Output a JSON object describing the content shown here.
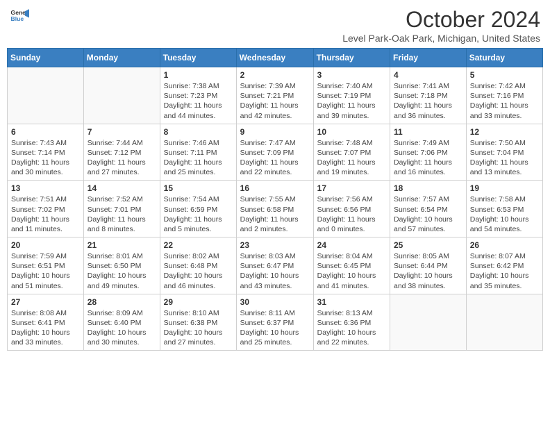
{
  "header": {
    "logo_line1": "General",
    "logo_line2": "Blue",
    "month_title": "October 2024",
    "location": "Level Park-Oak Park, Michigan, United States"
  },
  "weekdays": [
    "Sunday",
    "Monday",
    "Tuesday",
    "Wednesday",
    "Thursday",
    "Friday",
    "Saturday"
  ],
  "weeks": [
    [
      {
        "day": "",
        "info": ""
      },
      {
        "day": "",
        "info": ""
      },
      {
        "day": "1",
        "info": "Sunrise: 7:38 AM\nSunset: 7:23 PM\nDaylight: 11 hours and 44 minutes."
      },
      {
        "day": "2",
        "info": "Sunrise: 7:39 AM\nSunset: 7:21 PM\nDaylight: 11 hours and 42 minutes."
      },
      {
        "day": "3",
        "info": "Sunrise: 7:40 AM\nSunset: 7:19 PM\nDaylight: 11 hours and 39 minutes."
      },
      {
        "day": "4",
        "info": "Sunrise: 7:41 AM\nSunset: 7:18 PM\nDaylight: 11 hours and 36 minutes."
      },
      {
        "day": "5",
        "info": "Sunrise: 7:42 AM\nSunset: 7:16 PM\nDaylight: 11 hours and 33 minutes."
      }
    ],
    [
      {
        "day": "6",
        "info": "Sunrise: 7:43 AM\nSunset: 7:14 PM\nDaylight: 11 hours and 30 minutes."
      },
      {
        "day": "7",
        "info": "Sunrise: 7:44 AM\nSunset: 7:12 PM\nDaylight: 11 hours and 27 minutes."
      },
      {
        "day": "8",
        "info": "Sunrise: 7:46 AM\nSunset: 7:11 PM\nDaylight: 11 hours and 25 minutes."
      },
      {
        "day": "9",
        "info": "Sunrise: 7:47 AM\nSunset: 7:09 PM\nDaylight: 11 hours and 22 minutes."
      },
      {
        "day": "10",
        "info": "Sunrise: 7:48 AM\nSunset: 7:07 PM\nDaylight: 11 hours and 19 minutes."
      },
      {
        "day": "11",
        "info": "Sunrise: 7:49 AM\nSunset: 7:06 PM\nDaylight: 11 hours and 16 minutes."
      },
      {
        "day": "12",
        "info": "Sunrise: 7:50 AM\nSunset: 7:04 PM\nDaylight: 11 hours and 13 minutes."
      }
    ],
    [
      {
        "day": "13",
        "info": "Sunrise: 7:51 AM\nSunset: 7:02 PM\nDaylight: 11 hours and 11 minutes."
      },
      {
        "day": "14",
        "info": "Sunrise: 7:52 AM\nSunset: 7:01 PM\nDaylight: 11 hours and 8 minutes."
      },
      {
        "day": "15",
        "info": "Sunrise: 7:54 AM\nSunset: 6:59 PM\nDaylight: 11 hours and 5 minutes."
      },
      {
        "day": "16",
        "info": "Sunrise: 7:55 AM\nSunset: 6:58 PM\nDaylight: 11 hours and 2 minutes."
      },
      {
        "day": "17",
        "info": "Sunrise: 7:56 AM\nSunset: 6:56 PM\nDaylight: 11 hours and 0 minutes."
      },
      {
        "day": "18",
        "info": "Sunrise: 7:57 AM\nSunset: 6:54 PM\nDaylight: 10 hours and 57 minutes."
      },
      {
        "day": "19",
        "info": "Sunrise: 7:58 AM\nSunset: 6:53 PM\nDaylight: 10 hours and 54 minutes."
      }
    ],
    [
      {
        "day": "20",
        "info": "Sunrise: 7:59 AM\nSunset: 6:51 PM\nDaylight: 10 hours and 51 minutes."
      },
      {
        "day": "21",
        "info": "Sunrise: 8:01 AM\nSunset: 6:50 PM\nDaylight: 10 hours and 49 minutes."
      },
      {
        "day": "22",
        "info": "Sunrise: 8:02 AM\nSunset: 6:48 PM\nDaylight: 10 hours and 46 minutes."
      },
      {
        "day": "23",
        "info": "Sunrise: 8:03 AM\nSunset: 6:47 PM\nDaylight: 10 hours and 43 minutes."
      },
      {
        "day": "24",
        "info": "Sunrise: 8:04 AM\nSunset: 6:45 PM\nDaylight: 10 hours and 41 minutes."
      },
      {
        "day": "25",
        "info": "Sunrise: 8:05 AM\nSunset: 6:44 PM\nDaylight: 10 hours and 38 minutes."
      },
      {
        "day": "26",
        "info": "Sunrise: 8:07 AM\nSunset: 6:42 PM\nDaylight: 10 hours and 35 minutes."
      }
    ],
    [
      {
        "day": "27",
        "info": "Sunrise: 8:08 AM\nSunset: 6:41 PM\nDaylight: 10 hours and 33 minutes."
      },
      {
        "day": "28",
        "info": "Sunrise: 8:09 AM\nSunset: 6:40 PM\nDaylight: 10 hours and 30 minutes."
      },
      {
        "day": "29",
        "info": "Sunrise: 8:10 AM\nSunset: 6:38 PM\nDaylight: 10 hours and 27 minutes."
      },
      {
        "day": "30",
        "info": "Sunrise: 8:11 AM\nSunset: 6:37 PM\nDaylight: 10 hours and 25 minutes."
      },
      {
        "day": "31",
        "info": "Sunrise: 8:13 AM\nSunset: 6:36 PM\nDaylight: 10 hours and 22 minutes."
      },
      {
        "day": "",
        "info": ""
      },
      {
        "day": "",
        "info": ""
      }
    ]
  ]
}
